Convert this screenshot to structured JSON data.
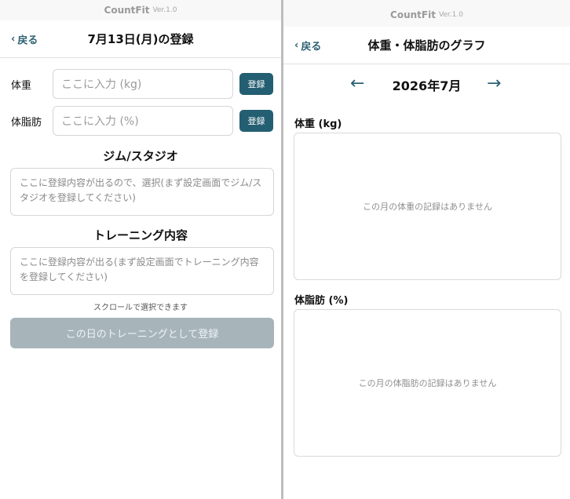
{
  "app": {
    "brand": "CountFit",
    "version": "Ver.1.0"
  },
  "entry": {
    "back_label": "戻る",
    "title": "7月13日(月)の登録",
    "weight": {
      "label": "体重",
      "placeholder": "ここに入力 (kg)",
      "button": "登録"
    },
    "bodyfat": {
      "label": "体脂肪",
      "placeholder": "ここに入力 (%)",
      "button": "登録"
    },
    "gym": {
      "title": "ジム/スタジオ",
      "text": "ここに登録内容が出るので、選択(まず設定画面でジム/スタジオを登録してください)"
    },
    "training": {
      "title": "トレーニング内容",
      "text": "ここに登録内容が出る(まず設定画面でトレーニング内容を登録してください)"
    },
    "scroll_hint": "スクロールで選択できます",
    "submit_label": "この日のトレーニングとして登録"
  },
  "graph": {
    "back_label": "戻る",
    "title": "体重・体脂肪のグラフ",
    "prev_arrow": "←",
    "next_arrow": "→",
    "month": "2026年7月",
    "weight_title": "体重 (kg)",
    "weight_empty": "この月の体重の記録はありません",
    "bodyfat_title": "体脂肪 (%)",
    "bodyfat_empty": "この月の体脂肪の記録はありません"
  },
  "colors": {
    "accent": "#245e72",
    "link": "#2c6174",
    "disabled": "#a7b5bb"
  }
}
